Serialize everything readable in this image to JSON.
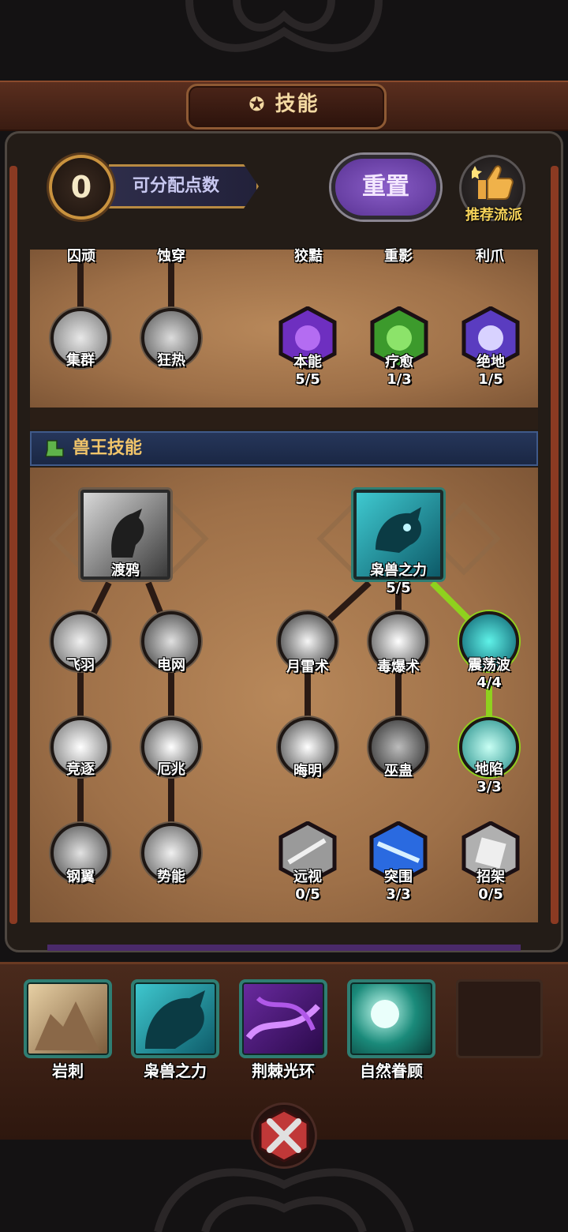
{
  "header": {
    "title": "技能"
  },
  "stats": {
    "points_value": "0",
    "points_label": "可分配点数"
  },
  "actions": {
    "reset_label": "重置",
    "recommend_label": "推荐流派"
  },
  "top_panel": {
    "partial_labels": [
      "囚顽",
      "蚀穿",
      "狡黠",
      "重影",
      "利爪"
    ],
    "skills": [
      {
        "label": "集群"
      },
      {
        "label": "狂热"
      },
      {
        "label": "本能",
        "count": "5/5"
      },
      {
        "label": "疗愈",
        "count": "1/3"
      },
      {
        "label": "绝地",
        "count": "1/5"
      }
    ]
  },
  "section": {
    "title": "兽王技能"
  },
  "tree_left": {
    "root": {
      "label": "渡鸦"
    },
    "col1": [
      {
        "label": "飞羽"
      },
      {
        "label": "竞逐"
      },
      {
        "label": "钢翼"
      }
    ],
    "col2": [
      {
        "label": "电网"
      },
      {
        "label": "厄兆"
      },
      {
        "label": "势能"
      }
    ]
  },
  "tree_right": {
    "root": {
      "label": "枭兽之力",
      "count": "5/5"
    },
    "col1": [
      {
        "label": "月雷术"
      },
      {
        "label": "晦明"
      },
      {
        "label": "远视",
        "count": "0/5"
      }
    ],
    "col2": [
      {
        "label": "毒爆术"
      },
      {
        "label": "巫蛊"
      },
      {
        "label": "突围",
        "count": "3/3"
      }
    ],
    "col3": [
      {
        "label": "震荡波",
        "count": "4/4"
      },
      {
        "label": "地陷",
        "count": "3/3"
      },
      {
        "label": "招架",
        "count": "0/5"
      }
    ]
  },
  "dock": {
    "slots": [
      {
        "label": "岩刺"
      },
      {
        "label": "枭兽之力"
      },
      {
        "label": "荆棘光环"
      },
      {
        "label": "自然眷顾"
      }
    ]
  },
  "colors": {
    "accent_gold": "#c9923e",
    "path_active": "#8fd11e",
    "path_inactive": "#2a1a14",
    "section_title": "#f2c56a"
  }
}
